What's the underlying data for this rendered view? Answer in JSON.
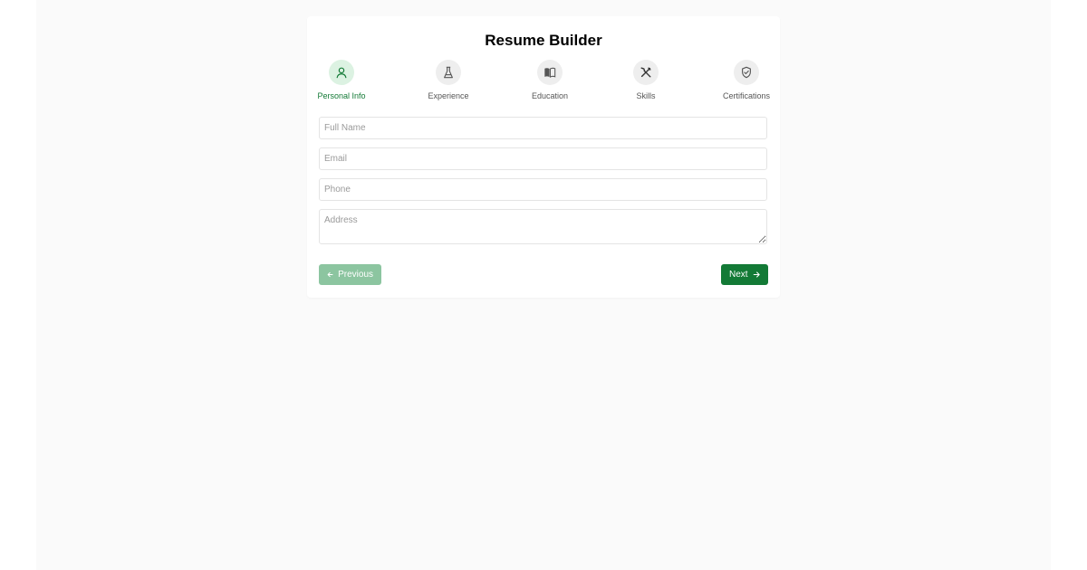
{
  "title": "Resume Builder",
  "steps": [
    {
      "label": "Personal Info",
      "icon": "user-icon",
      "active": true
    },
    {
      "label": "Experience",
      "icon": "flask-icon",
      "active": false
    },
    {
      "label": "Education",
      "icon": "book-icon",
      "active": false
    },
    {
      "label": "Skills",
      "icon": "tools-icon",
      "active": false
    },
    {
      "label": "Certifications",
      "icon": "shield-check-icon",
      "active": false
    }
  ],
  "form": {
    "full_name_placeholder": "Full Name",
    "email_placeholder": "Email",
    "phone_placeholder": "Phone",
    "address_placeholder": "Address"
  },
  "buttons": {
    "previous_label": "Previous",
    "next_label": "Next"
  },
  "colors": {
    "accent": "#137a36",
    "accent_disabled": "#8cc5a0",
    "active_step_bg": "#dcf2e2",
    "inactive_step_bg": "#eeeeee",
    "page_bg": "#fafafa"
  }
}
